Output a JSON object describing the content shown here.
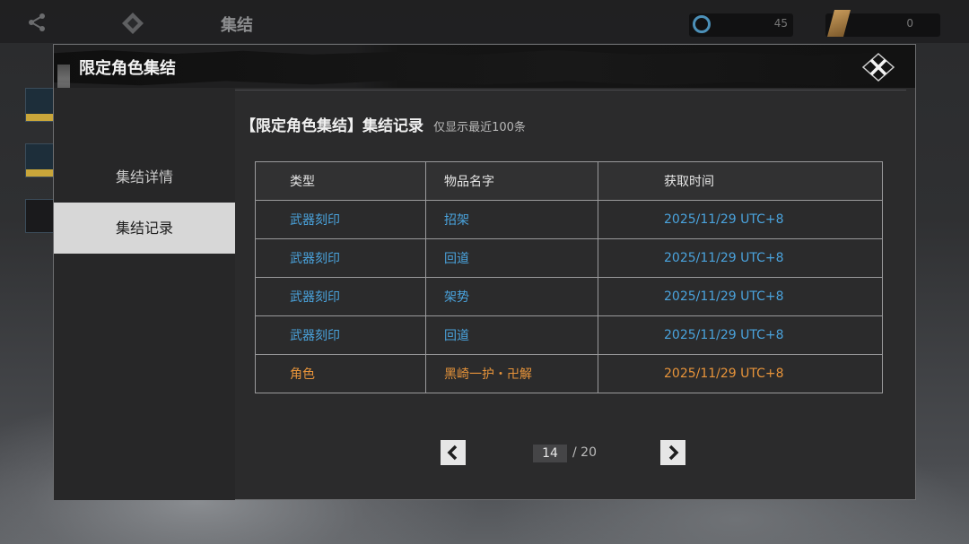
{
  "topbar": {
    "title": "集结",
    "currency1_value": "45",
    "currency2_value": "0"
  },
  "dialog": {
    "title": "限定角色集结",
    "close_icon": "close-x-icon"
  },
  "sidebar": {
    "items": [
      {
        "label": "集结详情",
        "active": false
      },
      {
        "label": "集结记录",
        "active": true
      }
    ]
  },
  "content": {
    "title": "【限定角色集结】集结记录",
    "subtitle": "仅显示最近100条"
  },
  "table": {
    "headers": [
      "类型",
      "物品名字",
      "获取时间"
    ],
    "rows": [
      {
        "type": "武器刻印",
        "name": "招架",
        "time": "2025/11/29 UTC+8",
        "color": "#4aa3dd"
      },
      {
        "type": "武器刻印",
        "name": "回道",
        "time": "2025/11/29 UTC+8",
        "color": "#4aa3dd"
      },
      {
        "type": "武器刻印",
        "name": "架势",
        "time": "2025/11/29 UTC+8",
        "color": "#4aa3dd"
      },
      {
        "type": "武器刻印",
        "name": "回道",
        "time": "2025/11/29 UTC+8",
        "color": "#4aa3dd"
      },
      {
        "type": "角色",
        "name": "黑崎一护・卍解",
        "time": "2025/11/29 UTC+8",
        "color": "#e8943a"
      }
    ]
  },
  "pagination": {
    "current": "14",
    "total": "/ 20",
    "prev_icon": "chevron-left-icon",
    "next_icon": "chevron-right-icon"
  }
}
